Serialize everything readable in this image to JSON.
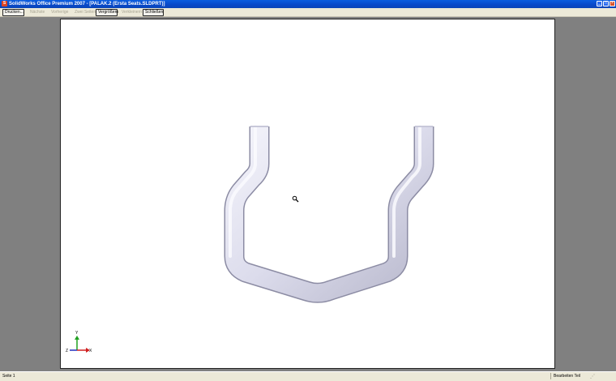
{
  "window": {
    "title": "SolidWorks Office Premium 2007 - [PALAK.2 (Ersta Seats.SLDPRT)]",
    "app_icon_glyph": "S",
    "min_glyph": "_",
    "max_glyph": "□",
    "close_glyph": "×"
  },
  "toolbar": {
    "buttons": [
      {
        "label": "Drucken...",
        "enabled": true
      },
      {
        "label": "Nächste",
        "enabled": false
      },
      {
        "label": "Vorherige",
        "enabled": false
      },
      {
        "label": "Zwei Seiten",
        "enabled": false
      },
      {
        "label": "Vergrößern",
        "enabled": true
      },
      {
        "label": "Verkleinern",
        "enabled": false
      },
      {
        "label": "Schließen",
        "enabled": true
      }
    ]
  },
  "viewport": {
    "cursor_icon": "magnifier-icon",
    "triad": {
      "x": "X",
      "y": "Y",
      "z": "Z",
      "x_color": "#d02020",
      "y_color": "#20a020",
      "z_color": "#2030c0"
    },
    "part_color": "#d9d9ec"
  },
  "statusbar": {
    "page_label": "Seite 1",
    "mode_label": "Bearbeiten Teil",
    "grip_glyph": "⋰"
  }
}
